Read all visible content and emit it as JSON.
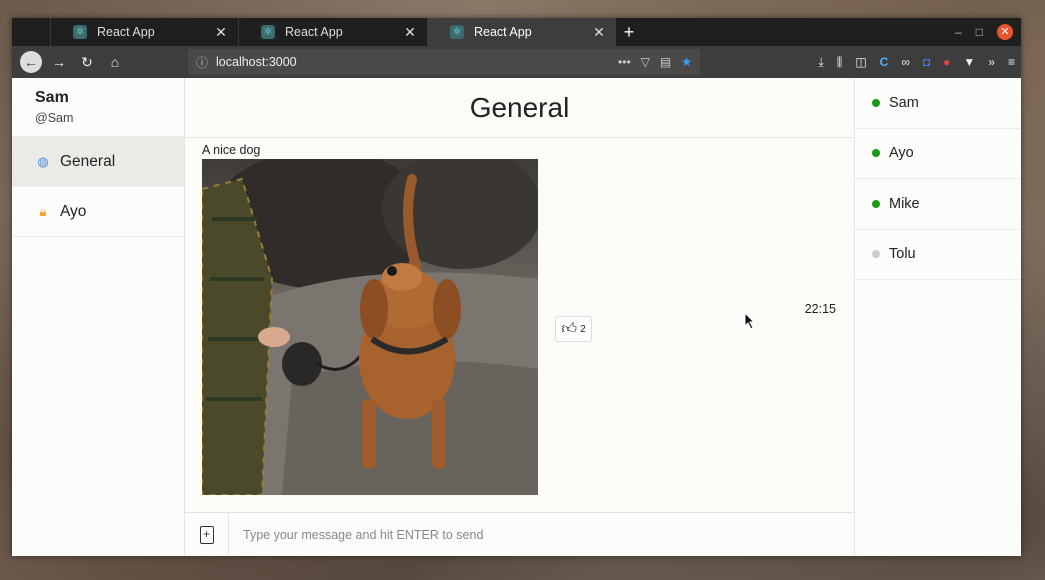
{
  "browser": {
    "tabs": [
      {
        "label": "React App",
        "active": false
      },
      {
        "label": "React App",
        "active": false
      },
      {
        "label": "React App",
        "active": true
      }
    ],
    "url": "localhost:3000",
    "new_tab_symbol": "+",
    "close_symbol": "✕"
  },
  "profile": {
    "name": "Sam",
    "handle": "@Sam"
  },
  "rooms": [
    {
      "label": "General",
      "icon": "globe-icon",
      "active": true
    },
    {
      "label": "Ayo",
      "icon": "lock-icon",
      "active": false
    }
  ],
  "channel": {
    "title": "General"
  },
  "message": {
    "caption": "A nice dog",
    "likes": "2",
    "time": "22:15"
  },
  "composer": {
    "placeholder": "Type your message and hit ENTER to send"
  },
  "users": [
    {
      "name": "Sam",
      "online": true
    },
    {
      "name": "Ayo",
      "online": true
    },
    {
      "name": "Mike",
      "online": true
    },
    {
      "name": "Tolu",
      "online": false
    }
  ],
  "colors": {
    "online": "#1a9a1a",
    "offline": "#cccccc",
    "accent_tab": "#3d3d3d"
  }
}
